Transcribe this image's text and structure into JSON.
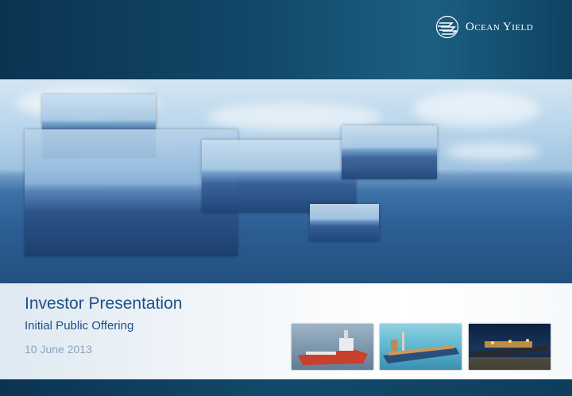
{
  "header": {
    "logo_text": "Ocean Yield",
    "logo_icon": "ocean-yield-wave-mark-icon"
  },
  "title": {
    "main": "Investor Presentation",
    "subtitle": "Initial Public Offering",
    "date": "10 June 2013"
  },
  "hero": {
    "image": "ocean-horizon-with-sky-collage",
    "tiles_count": 6
  },
  "photos": [
    {
      "name": "offshore-supply-vessel-photo"
    },
    {
      "name": "fpso-vessel-photo"
    },
    {
      "name": "night-vessel-photo"
    }
  ],
  "colors": {
    "brand_dark_blue": "#0b3352",
    "title_blue": "#1f4f86",
    "date_grey": "#8aa4bd"
  }
}
